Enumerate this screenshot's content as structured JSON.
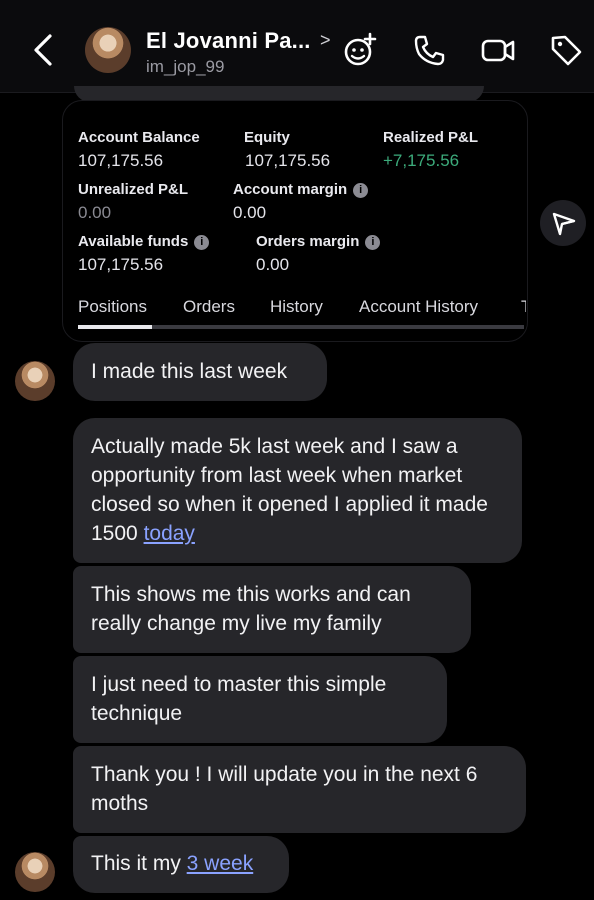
{
  "header": {
    "name": "El Jovanni Pa...",
    "username": "im_jop_99"
  },
  "shared_post": {
    "stats": [
      {
        "label": "Account Balance",
        "value": "107,175.56"
      },
      {
        "label": "Equity",
        "value": "107,175.56"
      },
      {
        "label": "Realized P&L",
        "value": "+7,175.56"
      },
      {
        "label": "Unrealized P&L",
        "value": "0.00"
      },
      {
        "label": "Account margin",
        "value": "0.00"
      },
      {
        "label": "Available funds",
        "value": "107,175.56"
      },
      {
        "label": "Orders margin",
        "value": "0.00"
      }
    ],
    "tabs": [
      "Positions",
      "Orders",
      "History",
      "Account History",
      "T"
    ]
  },
  "messages": [
    {
      "text": "I made this last week"
    },
    {
      "text": "Actually made 5k last week and I saw a opportunity from last week when market closed so when it opened I applied it made 1500 ",
      "link": "today"
    },
    {
      "text": "This shows me this works and can really change my live my family"
    },
    {
      "text": "I just need to master this simple technique"
    },
    {
      "text": "Thank you ! I will update you in the next 6 moths"
    },
    {
      "text": "This it my ",
      "link": "3 week"
    }
  ],
  "colors": {
    "bubble": "#26262a",
    "link": "#8aa2ff",
    "profit_green": "#3cab7b",
    "background": "#000000"
  }
}
